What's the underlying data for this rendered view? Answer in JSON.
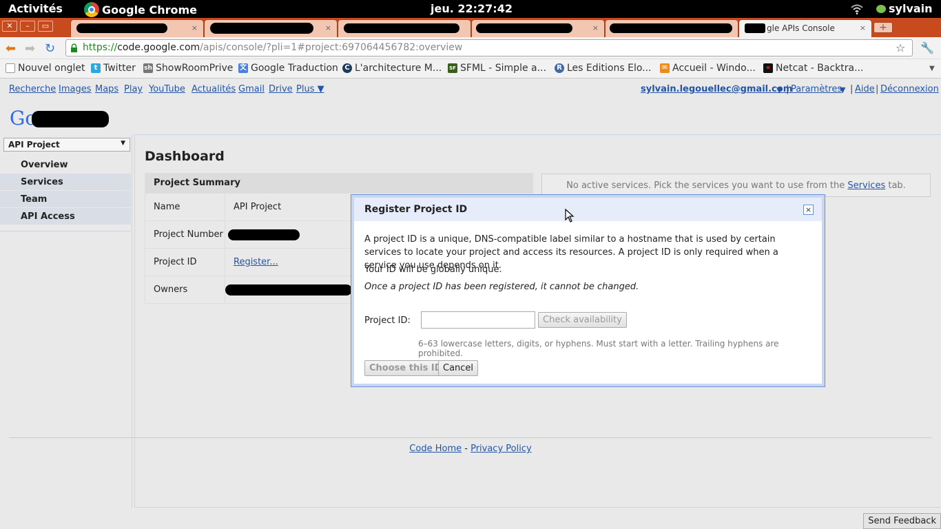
{
  "topbar": {
    "activities": "Activités",
    "app_name": "Google Chrome",
    "clock": "jeu. 22:27:42",
    "user": "sylvain"
  },
  "tabs": {
    "active_title": "gle APIs Console",
    "close_glyph": "×"
  },
  "toolbar": {
    "url_scheme": "https://",
    "url_host": "code.google.com",
    "url_rest": "/apis/console/?pli=1#project:697064456782:overview"
  },
  "bookmarks": [
    "Nouvel onglet",
    "Twitter",
    "ShowRoomPrive",
    "Google Traduction",
    "L'architecture M...",
    "SFML - Simple a...",
    "Les Editions Elo...",
    "Accueil - Windo...",
    "Netcat - Backtra..."
  ],
  "gbar": {
    "links": [
      "Recherche",
      "Images",
      "Maps",
      "Play",
      "YouTube",
      "Actualités",
      "Gmail",
      "Drive",
      "Plus ▼"
    ],
    "account": "sylvain.legouellec@gmail.com",
    "account_arrow": "▼",
    "settings": "Paramètres",
    "settings_arrow": "▼",
    "help": "Aide",
    "logout": "Déconnexion",
    "sep": "|"
  },
  "logo_text": "Go",
  "sidebar": {
    "project": "API Project",
    "items": [
      "Overview",
      "Services",
      "Team",
      "API Access"
    ]
  },
  "dashboard": {
    "title": "Dashboard",
    "summary_header": "Project Summary",
    "rows": {
      "name_label": "Name",
      "name_value": "API Project",
      "number_label": "Project Number",
      "id_label": "Project ID",
      "id_link": "Register...",
      "owners_label": "Owners"
    },
    "services_text_pre": "No active services. Pick the services you want to use from the ",
    "services_link": "Services",
    "services_text_post": " tab."
  },
  "dialog": {
    "title": "Register Project ID",
    "para1": "A project ID is a unique, DNS-compatible label similar to a hostname that is used by certain services to locate your project and access its resources. A project ID is only required when a service you use depends on it.",
    "para2": "Your ID will be globally unique.",
    "para3": "Once a project ID has been registered, it cannot be changed.",
    "field_label": "Project ID:",
    "field_value": "",
    "check_button": "Check availability",
    "hint": "6–63 lowercase letters, digits, or hyphens. Must start with a letter. Trailing hyphens are prohibited.",
    "choose_button": "Choose this ID",
    "cancel_button": "Cancel",
    "close_glyph": "×"
  },
  "footer": {
    "code_home": "Code Home",
    "dash": " - ",
    "privacy": "Privacy Policy"
  },
  "send_feedback": "Send Feedback",
  "colors": {
    "tabstrip": "#c84a1f",
    "link": "#2255aa",
    "dialog_border": "#6b90da",
    "url_green": "#1d8a1d"
  }
}
